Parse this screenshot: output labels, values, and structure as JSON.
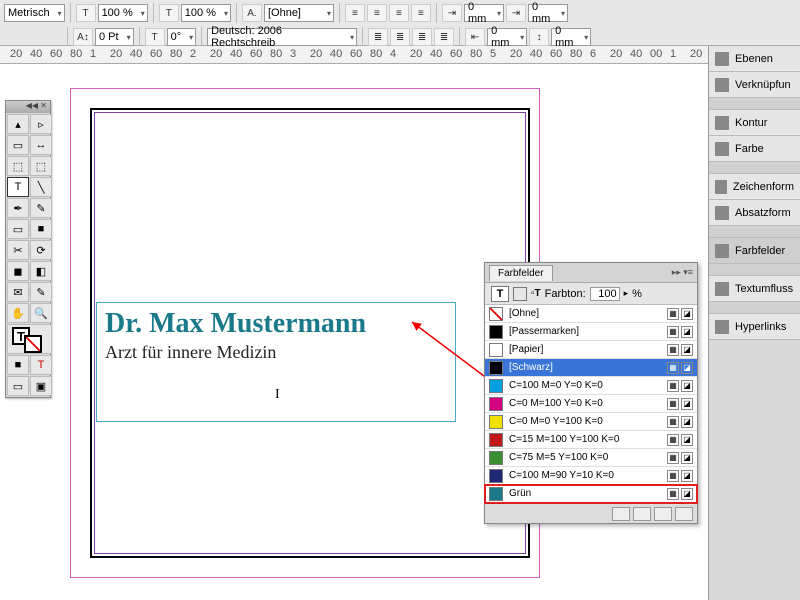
{
  "toolbar": {
    "metric_label": "Metrisch",
    "size1": "100 %",
    "size2": "100 %",
    "leading": "0 Pt",
    "rotation": "0°",
    "tracking_none": "[Ohne]",
    "spell": "Deutsch: 2006 Rechtschreib",
    "mm0": "0 mm"
  },
  "ruler": {
    "ticks": [
      "20",
      "40",
      "60",
      "80",
      "1",
      "20",
      "40",
      "60",
      "80",
      "2",
      "20",
      "40",
      "60",
      "80",
      "3",
      "20",
      "40",
      "60",
      "80",
      "4",
      "20",
      "40",
      "60",
      "80",
      "5",
      "20",
      "40",
      "60",
      "80",
      "6",
      "20",
      "40",
      "00",
      "1",
      "20"
    ]
  },
  "right_panel": [
    {
      "label": "Ebenen"
    },
    {
      "label": "Verknüpfun"
    },
    {
      "gap": true
    },
    {
      "label": "Kontur"
    },
    {
      "label": "Farbe"
    },
    {
      "gap": true
    },
    {
      "label": "Zeichenform"
    },
    {
      "label": "Absatzform"
    },
    {
      "gap": true
    },
    {
      "label": "Farbfelder",
      "sel": true
    },
    {
      "gap": true
    },
    {
      "label": "Textumfluss"
    },
    {
      "gap": true
    },
    {
      "label": "Hyperlinks"
    }
  ],
  "text": {
    "title": "Dr. Max Mustermann",
    "subtitle": "Arzt für innere Medizin"
  },
  "swatches": {
    "tab": "Farbfelder",
    "tint_label": "Farbton:",
    "tint_value": "100",
    "tint_suffix": "%",
    "rows": [
      {
        "name": "[Ohne]",
        "chip": "none"
      },
      {
        "name": "[Passermarken]",
        "chip": "#000"
      },
      {
        "name": "[Papier]",
        "chip": "#fff"
      },
      {
        "name": "[Schwarz]",
        "chip": "#000",
        "sel": true
      },
      {
        "name": "C=100 M=0 Y=0 K=0",
        "chip": "#00a0e0"
      },
      {
        "name": "C=0 M=100 Y=0 K=0",
        "chip": "#d4007f"
      },
      {
        "name": "C=0 M=0 Y=100 K=0",
        "chip": "#f0e000"
      },
      {
        "name": "C=15 M=100 Y=100 K=0",
        "chip": "#c01818"
      },
      {
        "name": "C=75 M=5 Y=100 K=0",
        "chip": "#3a9030"
      },
      {
        "name": "C=100 M=90 Y=10 K=0",
        "chip": "#202878"
      },
      {
        "name": "Grün",
        "chip": "#1a7a8a",
        "hl": true
      }
    ]
  }
}
